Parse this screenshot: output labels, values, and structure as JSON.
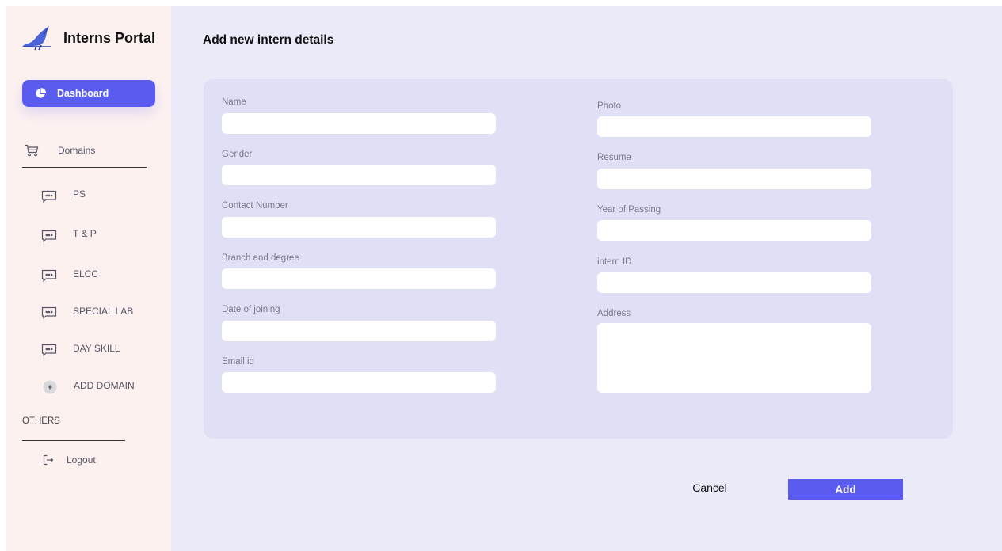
{
  "app": {
    "title": "Interns Portal"
  },
  "sidebar": {
    "dashboard_label": "Dashboard",
    "domains_label": "Domains",
    "domains": [
      {
        "label": "PS"
      },
      {
        "label": "T & P"
      },
      {
        "label": "ELCC"
      },
      {
        "label": "SPECIAL LAB"
      },
      {
        "label": "DAY SKILL"
      }
    ],
    "add_domain_label": "ADD DOMAIN",
    "others_label": "OTHERS",
    "logout_label": "Logout"
  },
  "form": {
    "title": "Add new intern details",
    "fields": {
      "name": {
        "label": "Name",
        "value": ""
      },
      "gender": {
        "label": "Gender",
        "value": ""
      },
      "contact": {
        "label": "Contact Number",
        "value": ""
      },
      "branch": {
        "label": "Branch and  degree",
        "value": ""
      },
      "doj": {
        "label": "Date of joining",
        "value": ""
      },
      "email": {
        "label": "Email id",
        "value": ""
      },
      "photo": {
        "label": "Photo",
        "value": ""
      },
      "resume": {
        "label": "Resume",
        "value": ""
      },
      "yop": {
        "label": "Year of Passing",
        "value": ""
      },
      "intern_id": {
        "label": "intern ID",
        "value": ""
      },
      "address": {
        "label": "Address",
        "value": ""
      }
    },
    "cancel_label": "Cancel",
    "add_label": "Add"
  },
  "icons": {
    "logo": "bird-logo-icon",
    "dashboard": "pie-chart-icon",
    "domains": "cart-icon",
    "domain_item": "chat-bubble-icon",
    "add_domain": "plus-circle-icon",
    "logout": "logout-icon"
  },
  "colors": {
    "accent": "#5a5cf0",
    "sidebar_bg": "#fdf1f0",
    "main_bg": "#ebeaf8",
    "card_bg": "#dfdff6"
  }
}
